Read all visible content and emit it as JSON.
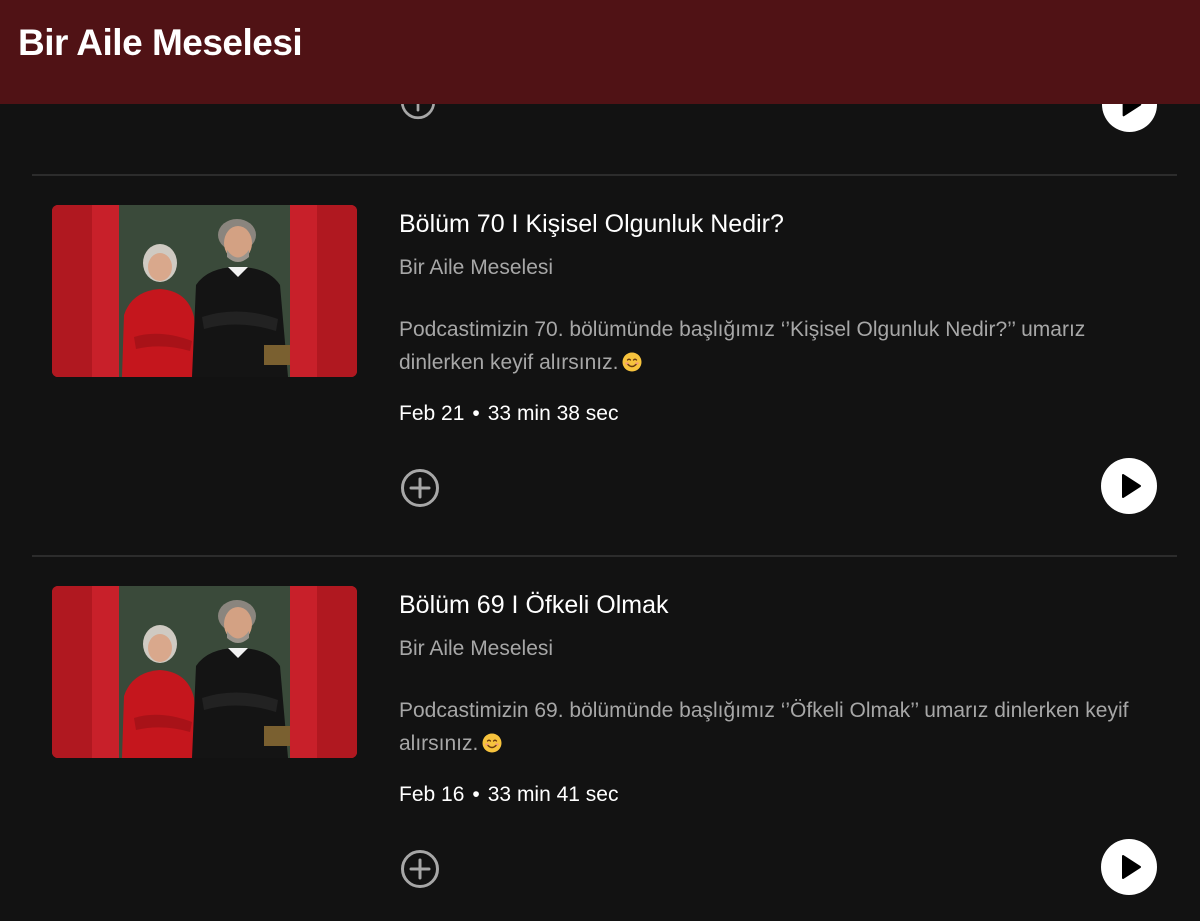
{
  "header": {
    "title": "Bir Aile Meselesi"
  },
  "colors": {
    "header_bg": "#501215",
    "page_bg": "#121212",
    "primary_text": "#ffffff",
    "secondary_text": "#a7a7a7",
    "cover_red": "#c8202a",
    "cover_green": "#3a4a3a"
  },
  "icons": {
    "add": "plus-circle-icon",
    "play": "play-icon",
    "emoji": "smiling-face-emoji"
  },
  "episodes": [
    {
      "title": "Bölüm 70 I Kişisel Olgunluk Nedir?",
      "show": "Bir Aile Meselesi",
      "description": "Podcastimizin 70. bölümünde başlığımız ‘’Kişisel Olgunluk Nedir?’’ umarız dinlerken keyif alırsınız.",
      "date": "Feb 21",
      "separator": "•",
      "duration": "33 min 38 sec"
    },
    {
      "title": "Bölüm 69 I Öfkeli Olmak",
      "show": "Bir Aile Meselesi",
      "description": "Podcastimizin 69. bölümünde başlığımız ‘’Öfkeli Olmak’’ umarız dinlerken keyif alırsınız.",
      "date": "Feb 16",
      "separator": "•",
      "duration": "33 min 41 sec"
    }
  ]
}
